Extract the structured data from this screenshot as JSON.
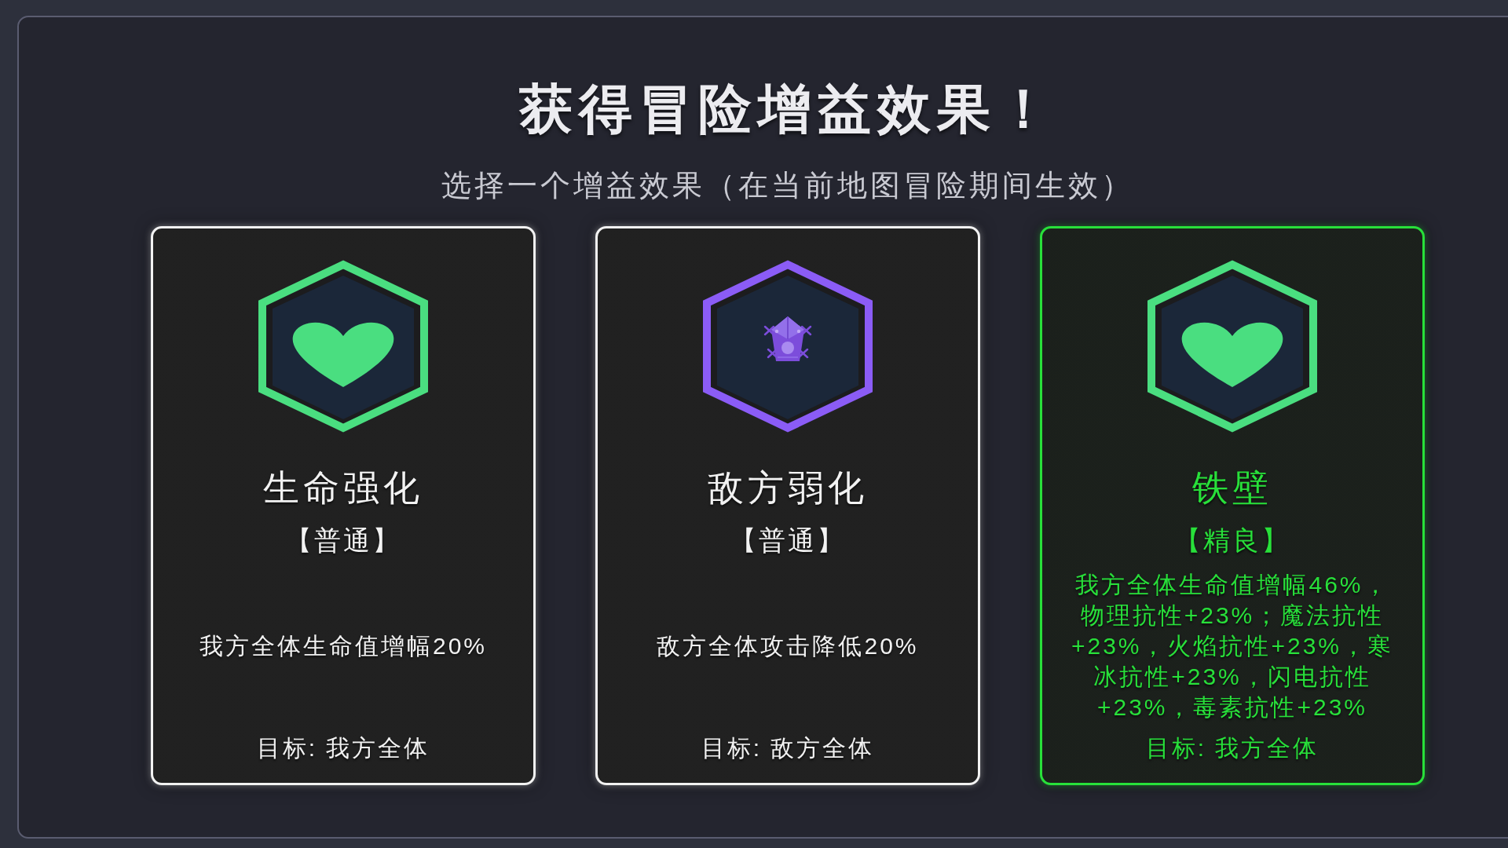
{
  "title": "获得冒险增益效果！",
  "subtitle": "选择一个增益效果（在当前地图冒险期间生效）",
  "cards": [
    {
      "name": "生命强化",
      "rarity": "【普通】",
      "color": "#f2f2f2",
      "icon": {
        "kind": "heart",
        "color": "#4ade80"
      },
      "description": "我方全体生命值增幅20%",
      "target": "目标: 我方全体"
    },
    {
      "name": "敌方弱化",
      "rarity": "【普通】",
      "color": "#f2f2f2",
      "icon": {
        "kind": "bug",
        "color": "#8b5cf6"
      },
      "description": "敌方全体攻击降低20%",
      "target": "目标: 敌方全体"
    },
    {
      "name": "铁壁",
      "rarity": "【精良】",
      "color": "#28e03a",
      "icon": {
        "kind": "heart",
        "color": "#4ade80"
      },
      "description": "我方全体生命值增幅46%，物理抗性+23%；魔法抗性+23%，火焰抗性+23%，寒冰抗性+23%，闪电抗性+23%，毒素抗性+23%",
      "target": "目标: 我方全体"
    }
  ]
}
